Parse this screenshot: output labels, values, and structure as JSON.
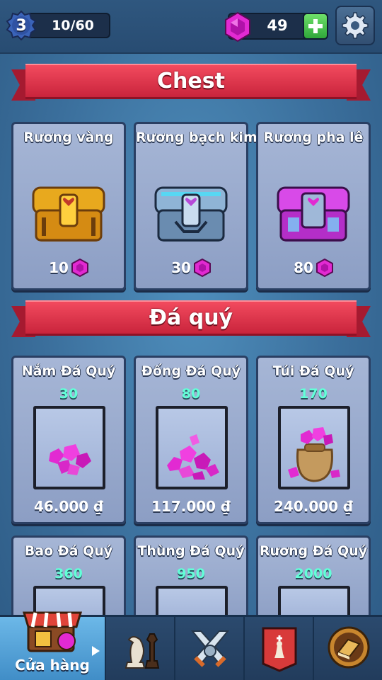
{
  "player": {
    "level": "3",
    "xp": "10/60"
  },
  "currency": {
    "gems": "49"
  },
  "colors": {
    "banner_red": "#e0344a",
    "gem_magenta": "#e22ad2",
    "gem_amount_teal": "#63ffd8",
    "card_bg": "#9aabce"
  },
  "sections": {
    "chest_title": "Chest",
    "gems_title": "Đá quý"
  },
  "chests": [
    {
      "name": "Rương vàng",
      "price": "10",
      "icon": "gold-chest-icon"
    },
    {
      "name": "Rương bạch kim",
      "price": "30",
      "icon": "platinum-chest-icon"
    },
    {
      "name": "Rương pha lê",
      "price": "80",
      "icon": "crystal-chest-icon"
    }
  ],
  "gem_packs": [
    {
      "name": "Nắm Đá Quý",
      "amount": "30",
      "price": "46.000 ₫",
      "icon": "gem-handful-icon"
    },
    {
      "name": "Đống Đá Quý",
      "amount": "80",
      "price": "117.000 ₫",
      "icon": "gem-pile-icon"
    },
    {
      "name": "Túi Đá Quý",
      "amount": "170",
      "price": "240.000 ₫",
      "icon": "gem-sack-icon"
    },
    {
      "name": "Bao Đá Quý",
      "amount": "360",
      "icon": "gem-bag-icon"
    },
    {
      "name": "Thùng Đá Quý",
      "amount": "950",
      "icon": "gem-crate-icon"
    },
    {
      "name": "Rương Đá Quý",
      "amount": "2000",
      "icon": "gem-chest-icon"
    }
  ],
  "nav": {
    "shop_label": "Cửa hàng",
    "items": [
      "shop-icon",
      "chess-pieces-icon",
      "crossed-swords-icon",
      "king-banner-icon",
      "book-icon"
    ]
  }
}
